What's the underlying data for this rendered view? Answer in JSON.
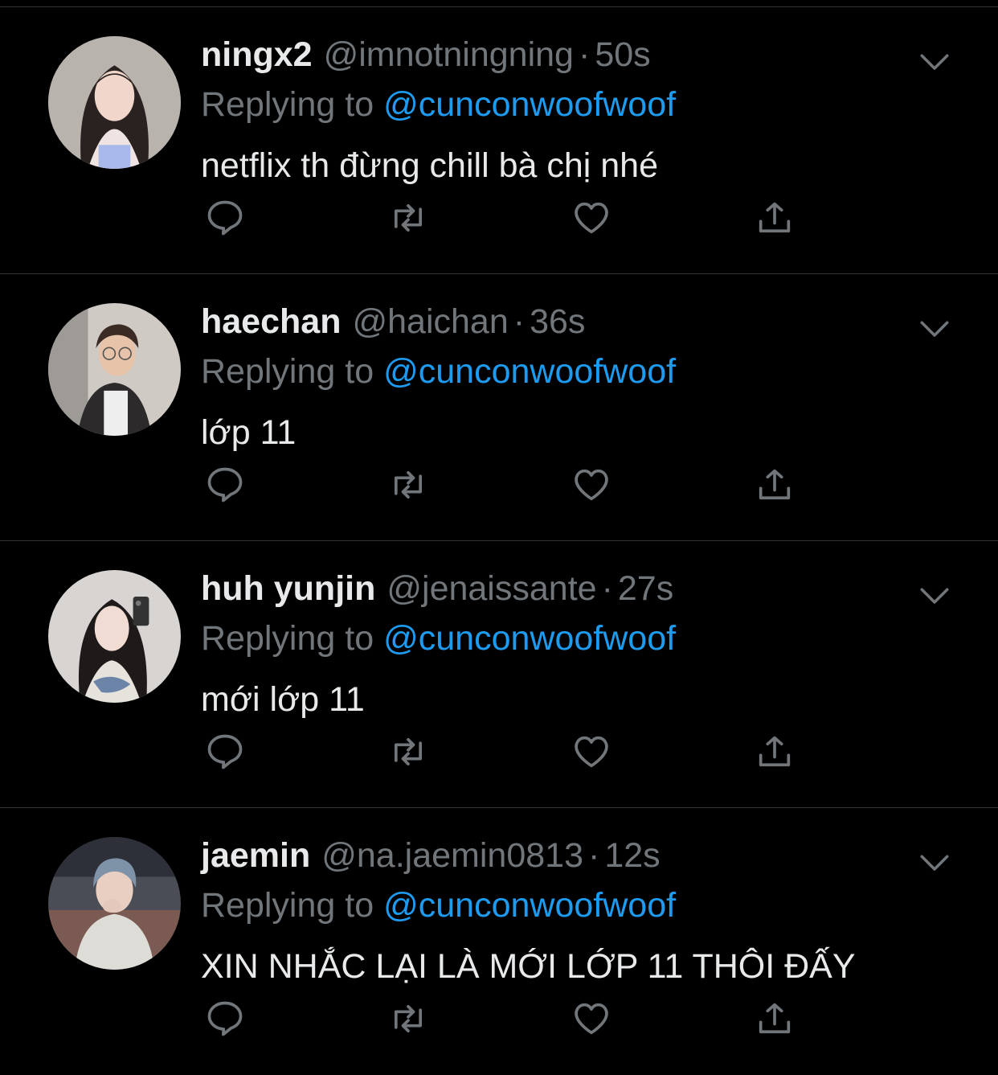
{
  "colors": {
    "background": "#000000",
    "text_primary": "#e7e9ea",
    "text_secondary": "#71767b",
    "accent": "#1d9bf0",
    "divider": "#2f3336"
  },
  "icons": {
    "reply": "speech-bubble-icon",
    "retweet": "retweet-arrows-icon",
    "like": "heart-icon",
    "share": "share-upload-icon",
    "menu": "chevron-down-icon"
  },
  "tweets": [
    {
      "display_name": "ningx2",
      "handle": "@imnotningning",
      "separator": "·",
      "time": "50s",
      "replying_prefix": "Replying to",
      "replying_to": "@cunconwoofwoof",
      "text": "netflix th đừng chill bà chị nhé"
    },
    {
      "display_name": "haechan",
      "handle": "@haichan",
      "separator": "·",
      "time": "36s",
      "replying_prefix": "Replying to",
      "replying_to": "@cunconwoofwoof",
      "text": "lớp 11"
    },
    {
      "display_name": "huh yunjin",
      "handle": "@jenaissante",
      "separator": "·",
      "time": "27s",
      "replying_prefix": "Replying to",
      "replying_to": "@cunconwoofwoof",
      "text": "mới lớp 11"
    },
    {
      "display_name": "jaemin",
      "handle": "@na.jaemin0813",
      "separator": "·",
      "time": "12s",
      "replying_prefix": "Replying to",
      "replying_to": "@cunconwoofwoof",
      "text": "XIN NHẮC LẠI LÀ MỚI LỚP 11 THÔI ĐẤY"
    }
  ]
}
